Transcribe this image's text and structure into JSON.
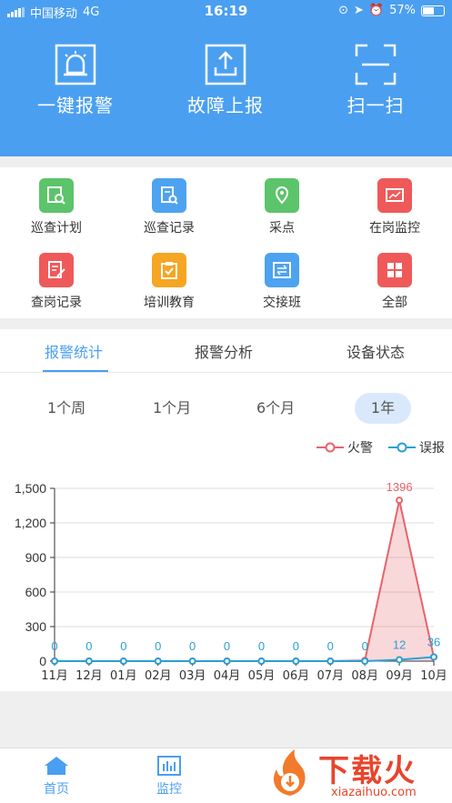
{
  "status_bar": {
    "carrier": "中国移动",
    "network": "4G",
    "time": "16:19",
    "battery": "57%"
  },
  "header_actions": [
    {
      "label": "一键报警",
      "icon": "alarm-light-icon"
    },
    {
      "label": "故障上报",
      "icon": "upload-icon"
    },
    {
      "label": "扫一扫",
      "icon": "scan-icon"
    }
  ],
  "grid": [
    {
      "label": "巡查计划",
      "color": "#5cc46a",
      "icon": "plan-search-icon"
    },
    {
      "label": "巡查记录",
      "color": "#4da3f0",
      "icon": "record-search-icon"
    },
    {
      "label": "采点",
      "color": "#5cc46a",
      "icon": "location-pin-icon"
    },
    {
      "label": "在岗监控",
      "color": "#f0595a",
      "icon": "monitor-chart-icon"
    },
    {
      "label": "查岗记录",
      "color": "#f0595a",
      "icon": "edit-document-icon"
    },
    {
      "label": "培训教育",
      "color": "#f5a623",
      "icon": "clipboard-check-icon"
    },
    {
      "label": "交接班",
      "color": "#4da3f0",
      "icon": "swap-icon"
    },
    {
      "label": "全部",
      "color": "#f0595a",
      "icon": "all-grid-icon"
    }
  ],
  "tabs": [
    "报警统计",
    "报警分析",
    "设备状态"
  ],
  "periods": [
    "1个周",
    "1个月",
    "6个月",
    "1年"
  ],
  "bottom_tabs": [
    {
      "label": "首页",
      "icon": "home-icon"
    },
    {
      "label": "监控",
      "icon": "bar-chart-icon"
    }
  ],
  "watermark": {
    "title": "下载火",
    "url": "xiazaihuo.com"
  },
  "chart_data": {
    "type": "area",
    "categories": [
      "11月",
      "12月",
      "01月",
      "02月",
      "03月",
      "04月",
      "05月",
      "06月",
      "07月",
      "08月",
      "09月",
      "10月"
    ],
    "series": [
      {
        "name": "火警",
        "color": "#e8636a",
        "values": [
          0,
          0,
          0,
          0,
          0,
          0,
          0,
          0,
          0,
          6,
          1396,
          36
        ]
      },
      {
        "name": "误报",
        "color": "#2a9fd6",
        "values": [
          0,
          0,
          0,
          0,
          0,
          0,
          0,
          0,
          0,
          0,
          12,
          36
        ]
      }
    ],
    "yticks": [
      "0",
      "300",
      "600",
      "900",
      "1,200",
      "1,500"
    ],
    "ylim": [
      0,
      1500
    ],
    "grid": true,
    "legend": "top-right"
  }
}
